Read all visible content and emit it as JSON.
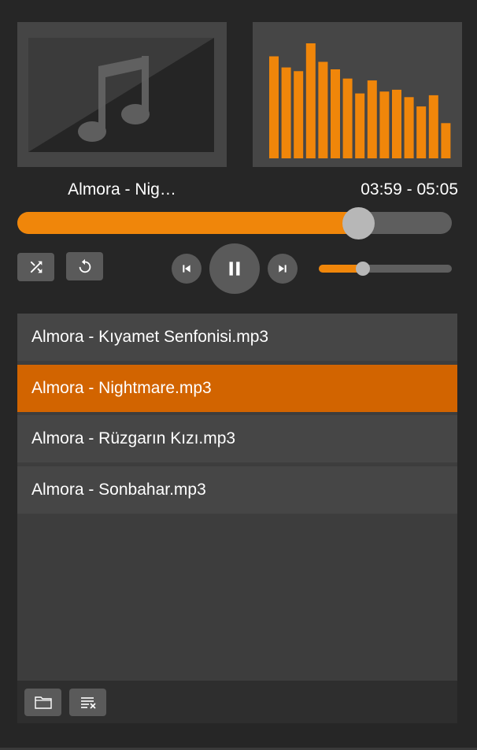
{
  "player": {
    "now_playing": "Almora - Nig…",
    "time": "03:59 - 05:05",
    "progress_fraction": 0.7836,
    "volume_fraction": 0.33,
    "accent_color": "#f0860a",
    "active_row_color": "#d26400"
  },
  "album_art": {
    "icon": "music-note-icon"
  },
  "visualizer": {
    "bar_levels": [
      0.55,
      0.49,
      0.47,
      0.62,
      0.52,
      0.48,
      0.43,
      0.35,
      0.42,
      0.36,
      0.37,
      0.33,
      0.28,
      0.34,
      0.19
    ]
  },
  "controls": {
    "shuffle_icon": "shuffle-icon",
    "repeat_icon": "repeat-icon",
    "prev_icon": "skip-previous-icon",
    "pause_icon": "pause-icon",
    "next_icon": "skip-next-icon"
  },
  "playlist": {
    "items": [
      {
        "label": "Almora - Kıyamet Senfonisi.mp3",
        "active": false
      },
      {
        "label": "Almora - Nightmare.mp3",
        "active": true
      },
      {
        "label": "Almora - Rüzgarın Kızı.mp3",
        "active": false
      },
      {
        "label": "Almora - Sonbahar.mp3",
        "active": false
      }
    ],
    "footer": {
      "open_icon": "folder-icon",
      "clear_icon": "clear-playlist-icon"
    }
  }
}
